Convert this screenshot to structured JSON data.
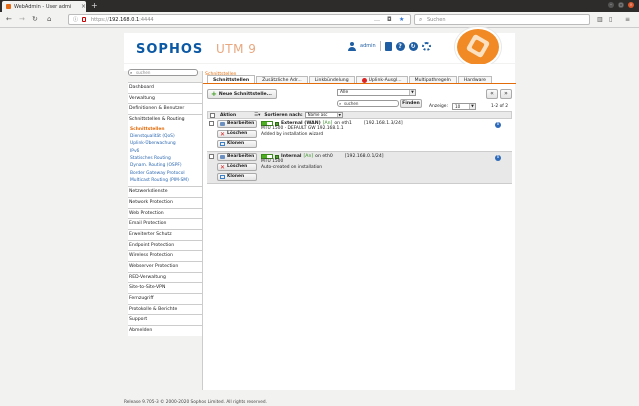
{
  "browser": {
    "tab_title": "WebAdmin - User admi",
    "new_tab": "+",
    "url_prefix": "https://",
    "url_host": "192.168.0.1",
    "url_port": ":4444",
    "search_placeholder": "Suchen"
  },
  "header": {
    "logo": "SOPHOS",
    "product": "UTM 9",
    "user": "admin"
  },
  "sidebar": {
    "search_placeholder": "suchen",
    "items_before": [
      "Dashboard",
      "Verwaltung",
      "Definitionen & Benutzer"
    ],
    "active_group": "Schnittstellen & Routing",
    "sub_items": [
      "Schnittstellen",
      "Dienstqualität (QoS)",
      "Uplink-Überwachung",
      "IPv6",
      "Statisches Routing",
      "Dynam. Routing (OSPF)",
      "Border Gateway Protocol",
      "Multicast Routing (PIM-SM)"
    ],
    "items_after": [
      "Netzwerkdienste",
      "Network Protection",
      "Web Protection",
      "Email Protection",
      "Erweiterter Schutz",
      "Endpoint Protection",
      "Wireless Protection",
      "Webserver Protection",
      "RED-Verwaltung",
      "Site-to-Site-VPN",
      "Fernzugriff",
      "Protokolle & Berichte",
      "Support",
      "Abmelden"
    ]
  },
  "content": {
    "breadcrumb": "Schnittstellen",
    "tabs": [
      "Schnittstellen",
      "Zusätzliche Adr...",
      "Linkbündelung",
      "Uplink-Ausgl...",
      "Multipathregeln",
      "Hardware"
    ],
    "new_button": "Neue Schnittstelle...",
    "filter_value": "Alle",
    "find_value": "suchen",
    "find_button": "Finden",
    "pager_prev": "«",
    "pager_next": "»",
    "anzeige_label": "Anzeige:",
    "anzeige_value": "10",
    "count": "1-2 of 2",
    "table_header": {
      "action": "Aktion",
      "sort_label": "Sortieren nach:",
      "sort_value": "Name asc"
    },
    "actions": {
      "edit": "Bearbeiten",
      "delete": "Löschen",
      "clone": "Klonen"
    },
    "rows": [
      {
        "name": "External (WAN)",
        "status": "[An]",
        "on": "on eth1",
        "addr": "[192.168.1.3/24]",
        "line2": "MTU 1500 · DEFAULT GW 192.168.1.1",
        "line3": "Added by installation wizard"
      },
      {
        "name": "Internal",
        "status": "[An]",
        "on": "on eth0",
        "addr": "[192.168.0.1/24]",
        "line2": "MTU 1500",
        "line3": "Auto-created on installation"
      }
    ]
  },
  "footer": "Release 9.705-3 © 2000-2020 Sophos Limited. All rights reserved."
}
